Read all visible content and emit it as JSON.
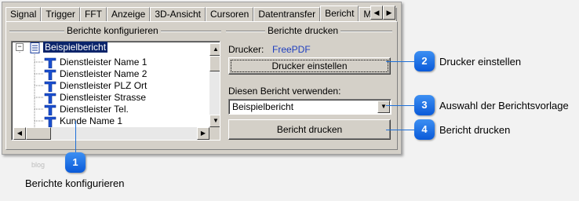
{
  "tabs": [
    "Signal",
    "Trigger",
    "FFT",
    "Anzeige",
    "3D-Ansicht",
    "Cursoren",
    "Datentransfer",
    "Bericht",
    "Melder"
  ],
  "active_tab": "Bericht",
  "left_group": {
    "title": "Berichte konfigurieren",
    "tree": {
      "root": "Beispielbericht",
      "items": [
        "Dienstleister Name 1",
        "Dienstleister Name 2",
        "Dienstleister PLZ Ort",
        "Dienstleister Strasse",
        "Dienstleister Tel.",
        "Kunde Name 1"
      ]
    }
  },
  "right_group": {
    "title": "Berichte drucken",
    "printer_label": "Drucker:",
    "printer_value": "FreePDF",
    "setup_button": "Drucker einstellen",
    "use_report_label": "Diesen Bericht verwenden:",
    "report_select_value": "Beispielbericht",
    "print_button": "Bericht drucken"
  },
  "callouts": [
    {
      "number": "1",
      "text": "Berichte konfigurieren"
    },
    {
      "number": "2",
      "text": "Drucker einstellen"
    },
    {
      "number": "3",
      "text": "Auswahl der Berichtsvorlage"
    },
    {
      "number": "4",
      "text": "Bericht drucken"
    }
  ],
  "watermark": "blog",
  "colors": {
    "accent": "#1d6fd8",
    "window": "#d4d0c8",
    "printer_value": "#1f3fbf",
    "selection": "#0a246a"
  }
}
